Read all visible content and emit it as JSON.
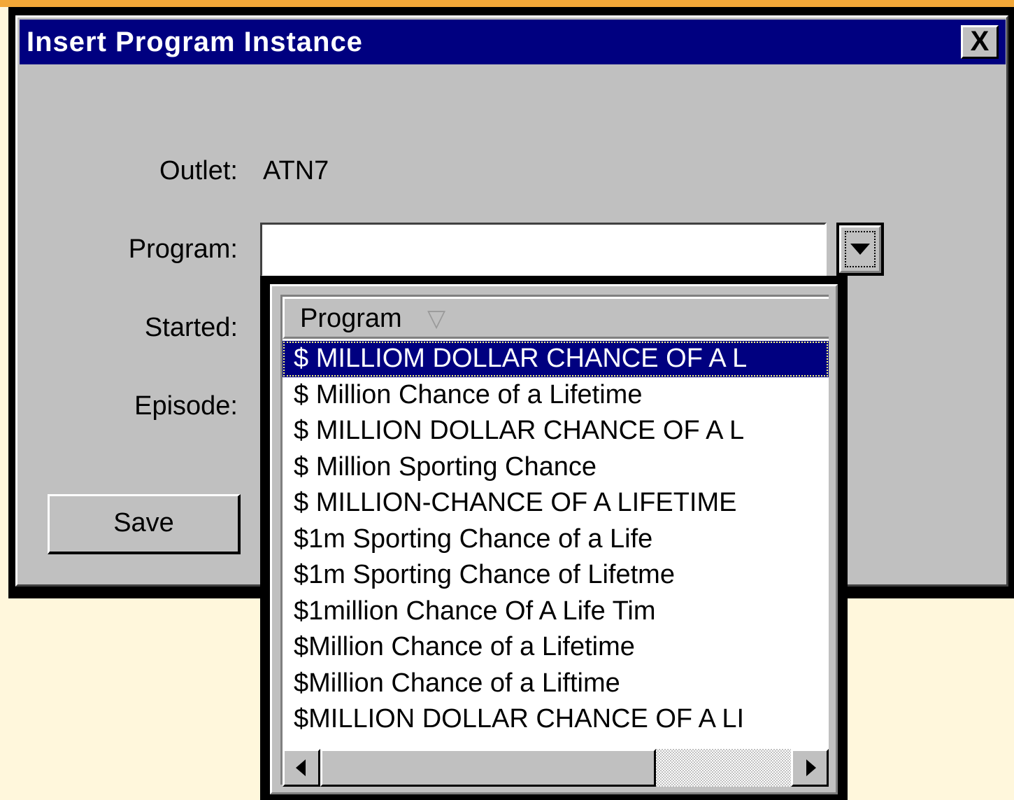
{
  "window": {
    "title": "Insert Program Instance",
    "close_glyph": "X",
    "close_icon": "close-icon"
  },
  "form": {
    "outlet_label": "Outlet:",
    "outlet_value": "ATN7",
    "program_label": "Program:",
    "program_value": "",
    "started_label": "Started:",
    "episode_label": "Episode:",
    "dropdown_icon": "chevron-down-icon",
    "save_label": "Save"
  },
  "dropdown": {
    "column_header": "Program",
    "sort_icon": "sort-descending-icon",
    "sort_glyph": "▽",
    "selected_index": 0,
    "items": [
      "$ MILLIOM DOLLAR CHANCE OF A L",
      "$ Million Chance of a Lifetime",
      "$ MILLION DOLLAR CHANCE OF A L",
      "$ Million Sporting Chance",
      "$ MILLION-CHANCE OF A LIFETIME",
      "$1m Sporting Chance of a Life",
      "$1m Sporting Chance of Lifetme",
      "$1million Chance Of A Life Tim",
      "$Million Chance of a Lifetime",
      "$Million Chance of a Liftime",
      "$MILLION DOLLAR CHANCE OF A LI"
    ],
    "scroll_left_icon": "scroll-left-icon",
    "scroll_right_icon": "scroll-right-icon"
  },
  "colors": {
    "title_bar": "#000080",
    "dialog_face": "#c0c0c0",
    "selection": "#000080",
    "background": "#fff7dc",
    "accent_strip": "#f3a838"
  }
}
